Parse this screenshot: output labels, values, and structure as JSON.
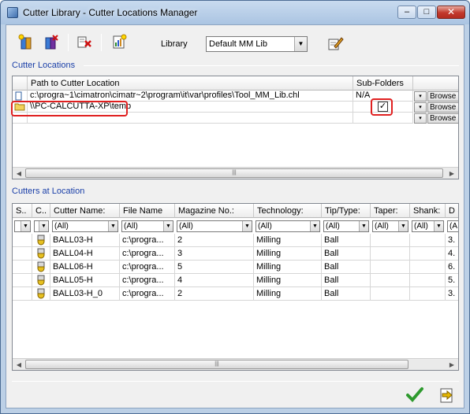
{
  "window": {
    "title": "Cutter Library - Cutter Locations Manager",
    "minimize_glyph": "–",
    "maximize_glyph": "□",
    "close_glyph": "✕"
  },
  "toolbar": {
    "buttons": [
      "add-location-icon",
      "delete-location-icon",
      "remove-icon",
      "report-icon"
    ],
    "library_label": "Library",
    "library_value": "Default MM Lib",
    "edit_icon": "edit-pencil-icon"
  },
  "cutter_locations": {
    "group_title": "Cutter Locations",
    "columns": [
      "Path to Cutter Location",
      "Sub-Folders"
    ],
    "rows": [
      {
        "path": "c:\\progra~1\\cimatron\\cimatr~2\\program\\it\\var\\profiles\\Tool_MM_Lib.chl",
        "subfolders": "N/A",
        "browse": "Browse"
      },
      {
        "path": "\\\\PC-CALCUTTA-XP\\temp",
        "subfolders_checked": true,
        "browse": "Browse"
      },
      {
        "path": "",
        "browse": "Browse"
      }
    ]
  },
  "cutters_at_location": {
    "group_title": "Cutters at Location",
    "columns": [
      "S..",
      "C..",
      "Cutter Name:",
      "File Name",
      "Magazine No.:",
      "Technology:",
      "Tip/Type:",
      "Taper:",
      "Shank:",
      "D"
    ],
    "filter_value": "(All)",
    "filter_partial": "(A",
    "rows": [
      {
        "name": "BALL03-H",
        "file": "c:\\progra...",
        "magazine": "2",
        "technology": "Milling",
        "tip": "Ball",
        "d": "3."
      },
      {
        "name": "BALL04-H",
        "file": "c:\\progra...",
        "magazine": "3",
        "technology": "Milling",
        "tip": "Ball",
        "d": "4."
      },
      {
        "name": "BALL06-H",
        "file": "c:\\progra...",
        "magazine": "5",
        "technology": "Milling",
        "tip": "Ball",
        "d": "6."
      },
      {
        "name": "BALL05-H",
        "file": "c:\\progra...",
        "magazine": "4",
        "technology": "Milling",
        "tip": "Ball",
        "d": "5."
      },
      {
        "name": "BALL03-H_0",
        "file": "c:\\progra...",
        "magazine": "2",
        "technology": "Milling",
        "tip": "Ball",
        "d": "3."
      }
    ]
  },
  "footer": {
    "ok_icon": "checkmark-icon",
    "exit_icon": "exit-icon"
  },
  "colors": {
    "group_title": "#1a3fa8",
    "highlight": "#e02020",
    "ok_green": "#2e9a2e"
  }
}
